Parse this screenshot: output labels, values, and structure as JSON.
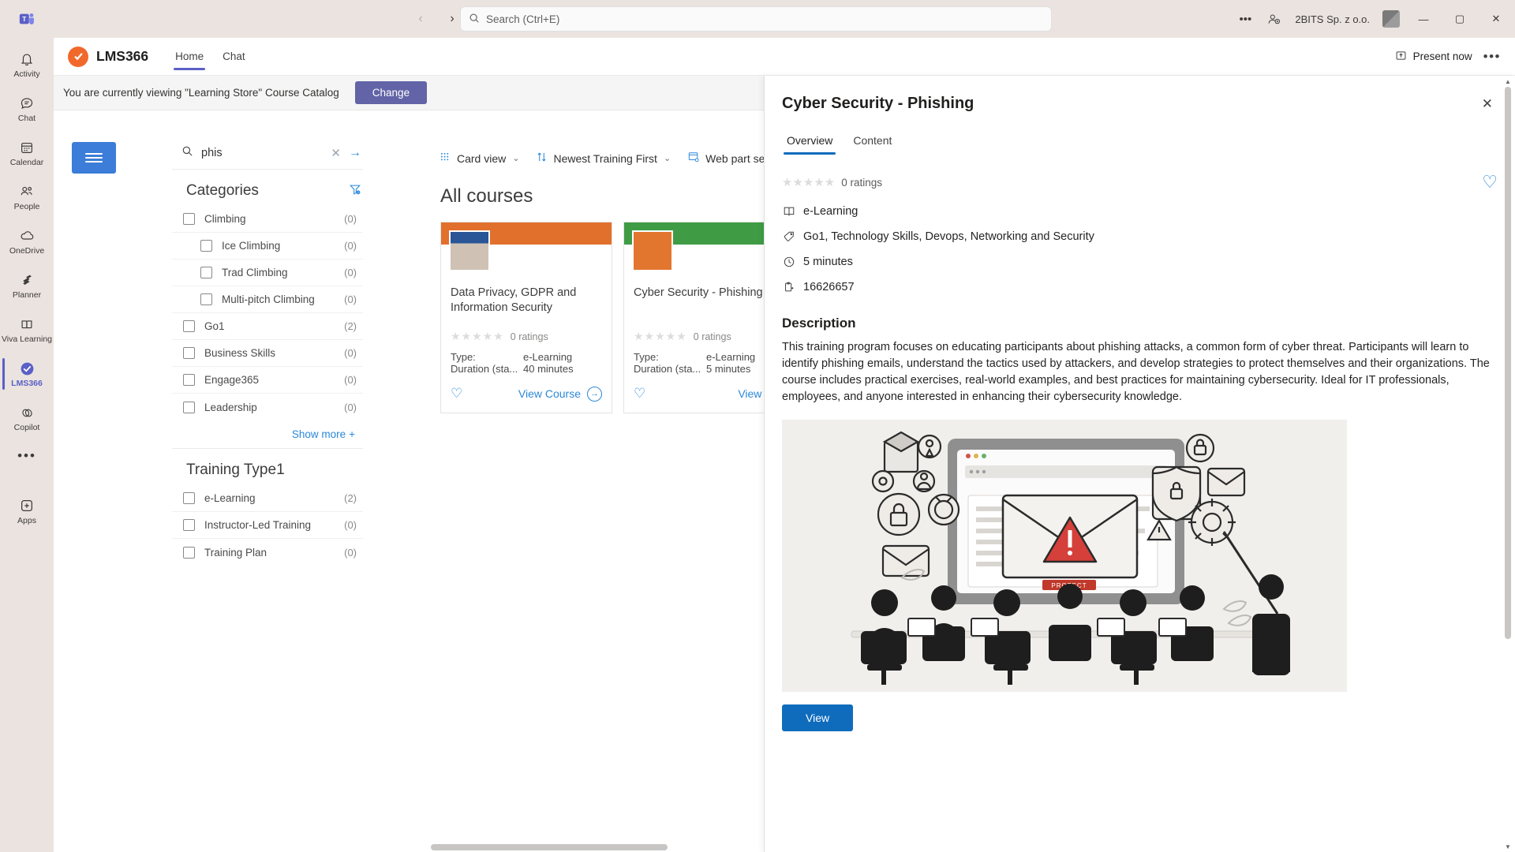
{
  "titlebar": {
    "app_icon": "teams-icon",
    "back_label": "‹",
    "forward_label": "›",
    "search_placeholder": "Search (Ctrl+E)",
    "search_value": "",
    "more_label": "•••",
    "tenant": "2BITS Sp. z o.o.",
    "minimize": "—",
    "maximize": "▢",
    "close": "✕"
  },
  "rail": {
    "items": [
      {
        "label": "Activity",
        "icon": "bell-icon"
      },
      {
        "label": "Chat",
        "icon": "chat-bubble-icon"
      },
      {
        "label": "Calendar",
        "icon": "calendar-icon"
      },
      {
        "label": "People",
        "icon": "people-icon"
      },
      {
        "label": "OneDrive",
        "icon": "cloud-icon"
      },
      {
        "label": "Planner",
        "icon": "planner-icon"
      },
      {
        "label": "Viva Learning",
        "icon": "viva-learning-icon"
      },
      {
        "label": "LMS366",
        "icon": "lms366-icon"
      },
      {
        "label": "Copilot",
        "icon": "copilot-icon"
      }
    ],
    "active": "LMS366",
    "more_label": "•••",
    "apps_label": "Apps"
  },
  "app_header": {
    "title": "LMS366",
    "tabs": [
      {
        "label": "Home",
        "active": true
      },
      {
        "label": "Chat",
        "active": false
      }
    ],
    "present_now": "Present now",
    "more_label": "•••"
  },
  "banner": {
    "text": "You are currently viewing \"Learning Store\" Course Catalog",
    "button": "Change"
  },
  "search": {
    "value": "phis",
    "clear_label": "✕",
    "submit_label": "→"
  },
  "filters": {
    "categories_title": "Categories",
    "categories": [
      {
        "label": "Climbing",
        "count": "(0)",
        "indent": false
      },
      {
        "label": "Ice Climbing",
        "count": "(0)",
        "indent": true
      },
      {
        "label": "Trad Climbing",
        "count": "(0)",
        "indent": true
      },
      {
        "label": "Multi-pitch Climbing",
        "count": "(0)",
        "indent": true
      },
      {
        "label": "Go1",
        "count": "(2)",
        "indent": false
      },
      {
        "label": "Business Skills",
        "count": "(0)",
        "indent": false
      },
      {
        "label": "Engage365",
        "count": "(0)",
        "indent": false
      },
      {
        "label": "Leadership",
        "count": "(0)",
        "indent": false
      }
    ],
    "show_more": "Show more",
    "show_more_plus": "+",
    "training_type_title": "Training Type1",
    "training_types": [
      {
        "label": "e-Learning",
        "count": "(2)"
      },
      {
        "label": "Instructor-Led Training",
        "count": "(0)"
      },
      {
        "label": "Training Plan",
        "count": "(0)"
      }
    ]
  },
  "toolbar": {
    "card_view": "Card view",
    "sort": "Newest Training First",
    "web_part_settings": "Web part settings",
    "chevron": "⌄"
  },
  "catalog": {
    "heading": "All courses",
    "cards": [
      {
        "title": "Data Privacy, GDPR and Information Security",
        "accent": "#e2702d",
        "rating_text": "0 ratings",
        "type_key": "Type:",
        "type_value": "e-Learning",
        "duration_key": "Duration (sta...",
        "duration_value": "40 minutes",
        "action": "View Course"
      },
      {
        "title": "Cyber Security - Phishing",
        "accent": "#3f9c45",
        "rating_text": "0 ratings",
        "type_key": "Type:",
        "type_value": "e-Learning",
        "duration_key": "Duration (sta...",
        "duration_value": "5 minutes",
        "action": "View Cou"
      }
    ]
  },
  "panel": {
    "title": "Cyber Security - Phishing",
    "close_label": "✕",
    "tabs": [
      {
        "label": "Overview",
        "active": true
      },
      {
        "label": "Content",
        "active": false
      }
    ],
    "rating_text": "0 ratings",
    "favorite_icon": "heart-icon",
    "meta": [
      {
        "icon": "book-icon",
        "text": "e-Learning"
      },
      {
        "icon": "tag-icon",
        "text": "Go1, Technology Skills, Devops, Networking and Security"
      },
      {
        "icon": "clock-icon",
        "text": "5 minutes"
      },
      {
        "icon": "clipboard-icon",
        "text": "16626657"
      }
    ],
    "description_heading": "Description",
    "description": "This training program focuses on educating participants about phishing attacks, a common form of cyber threat. Participants will learn to identify phishing emails, understand the tactics used by attackers, and develop strategies to protect themselves and their organizations. The course includes practical exercises, real-world examples, and best practices for maintaining cybersecurity. Ideal for IT professionals, employees, and anyone interested in enhancing their cybersecurity knowledge.",
    "hero_alt": "illustration of a security awareness training session with a phishing email warning on a large screen",
    "hero_badge": "PROTECT",
    "view_button": "View"
  },
  "colors": {
    "teams_chrome": "#ebe3df",
    "accent_purple": "#6264a7",
    "link_blue": "#2b88d8",
    "primary_blue": "#0f6cbd",
    "brand_orange": "#f0692b"
  }
}
